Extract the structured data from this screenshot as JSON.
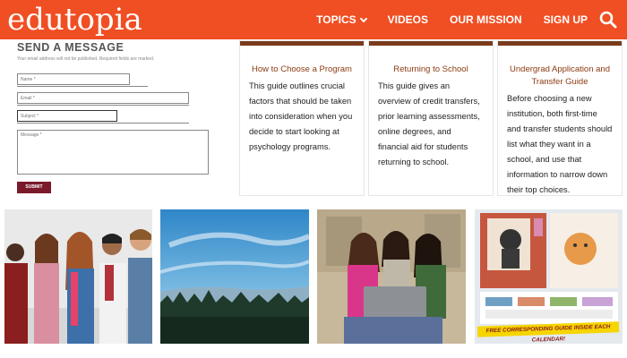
{
  "header": {
    "logo": "edutopia",
    "nav": {
      "topics": "TOPICS",
      "videos": "VIDEOS",
      "our_mission": "OUR MISSION",
      "sign_up": "SIGN UP"
    },
    "search_icon": "search-icon",
    "bg_color": "#f04e23"
  },
  "form": {
    "title": "SEND A MESSAGE",
    "note": "Your email address will not be published. Required fields are marked.",
    "name_placeholder": "Name *",
    "email_placeholder": "Email *",
    "subject_placeholder": "Subject *",
    "message_placeholder": "Message *",
    "submit_label": "SUBMIT",
    "submit_color": "#7a1a2a"
  },
  "cards": [
    {
      "title": "How to Choose a Program",
      "body": "This guide outlines crucial factors that should be taken into consideration when you decide to start looking at psychology programs."
    },
    {
      "title": "Returning to School",
      "body": "This guide gives an overview of credit transfers, prior learning assessments, online degrees, and financial aid for students returning to school."
    },
    {
      "title": "Undergrad Application and Transfer Guide",
      "body": "Before choosing a new institution, both first-time and transfer students should list what they want in a school, and use that information to narrow down their top choices."
    }
  ],
  "tiles": {
    "calendar_banner": "FREE CORRESPONDING GUIDE INSIDE EACH CALENDAR!"
  }
}
